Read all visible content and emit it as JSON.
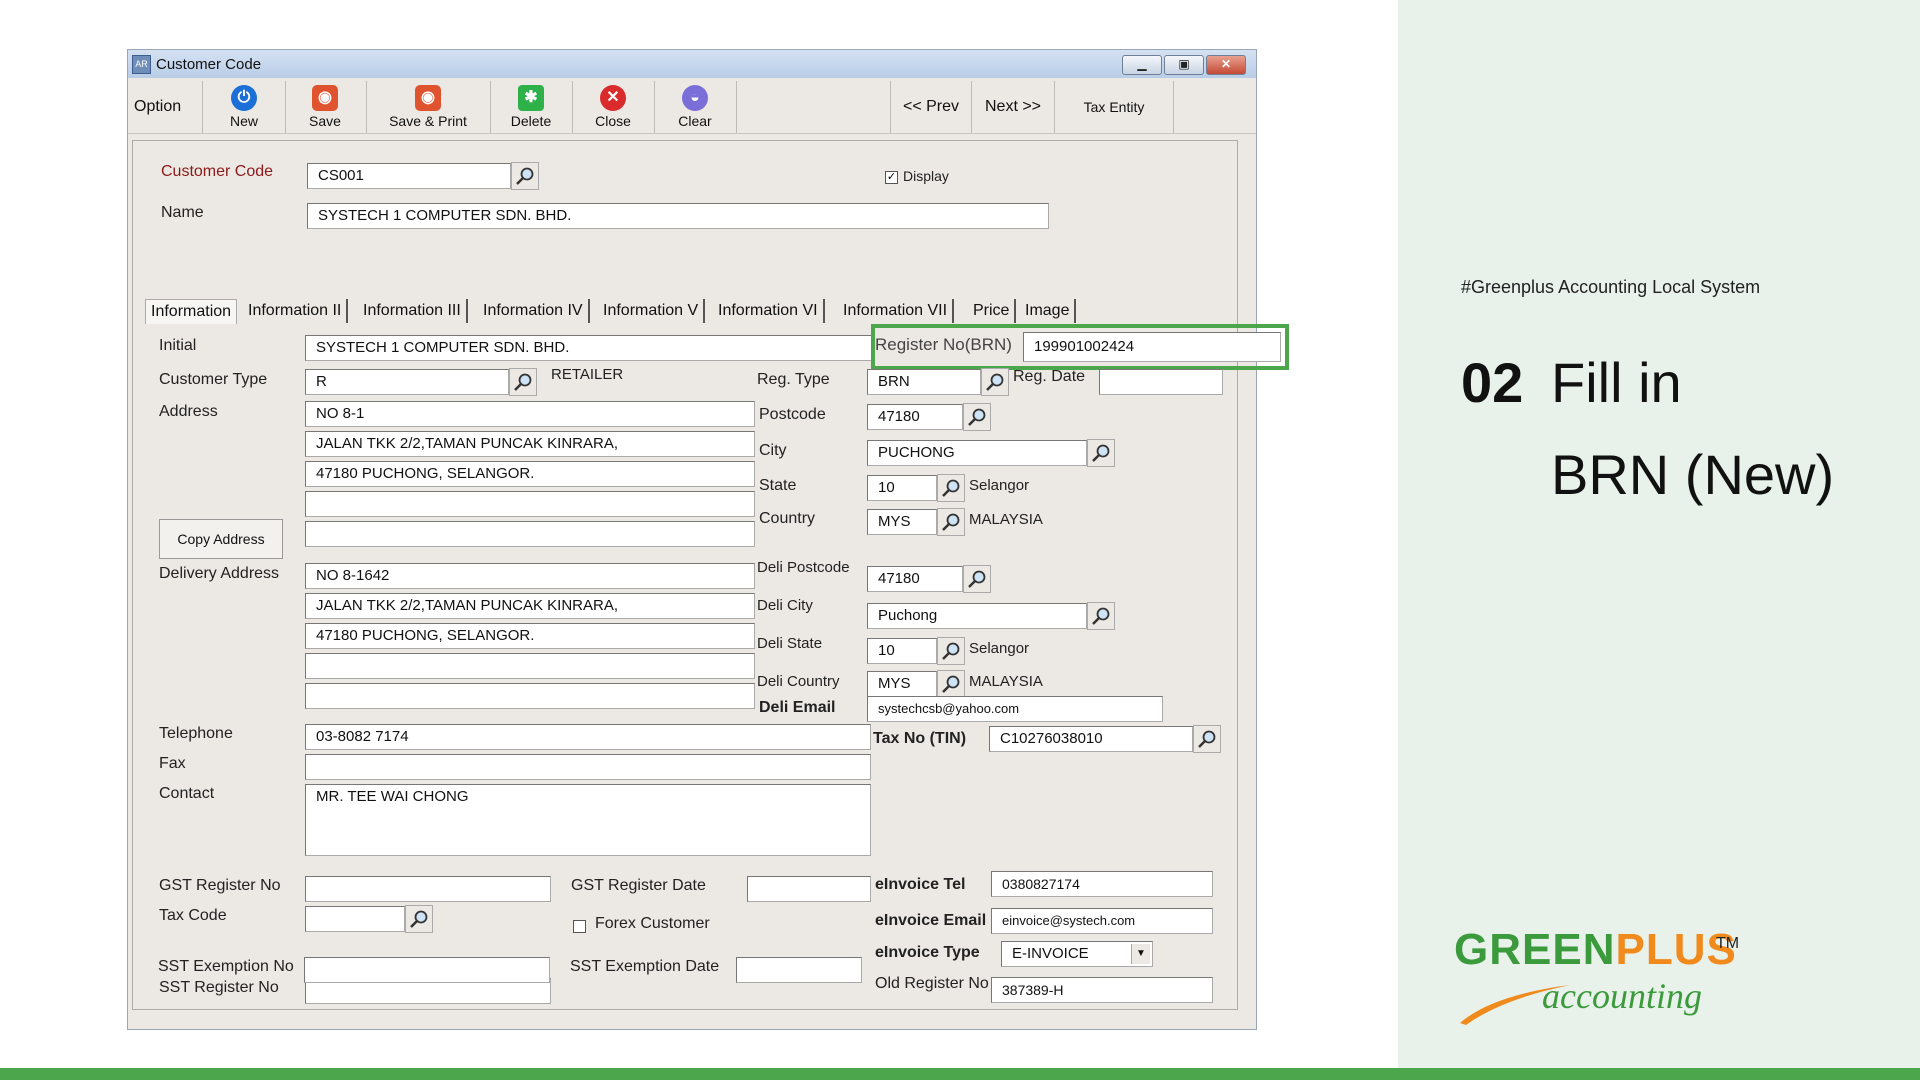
{
  "slide": {
    "hashtag": "#Greenplus Accounting Local System",
    "step_number": "02",
    "step_line1": "Fill in",
    "step_line2": "BRN (New)",
    "logo_green": "GREEN",
    "logo_plus": "PLUS",
    "logo_tm": "TM",
    "logo_accounting": "accounting"
  },
  "window": {
    "title": "Customer Code",
    "app_icon": "AR",
    "controls": [
      "minimize-icon",
      "maximize-icon",
      "close-icon"
    ]
  },
  "toolbar": {
    "option": "Option",
    "new": "New",
    "save": "Save",
    "save_print": "Save & Print",
    "delete": "Delete",
    "close": "Close",
    "clear": "Clear",
    "prev": "<<  Prev",
    "next": "Next  >>",
    "tax_entity": "Tax Entity"
  },
  "header": {
    "customer_code_label": "Customer Code",
    "customer_code": "CS001",
    "display_label": "Display",
    "display_checked": "✓",
    "name_label": "Name",
    "name": "SYSTECH 1 COMPUTER SDN. BHD."
  },
  "tabs": [
    "Information",
    "Information II",
    "Information III",
    "Information IV",
    "Information V",
    "Information VI",
    "Information VII",
    "Price",
    "Image"
  ],
  "form": {
    "initial_label": "Initial",
    "initial": "SYSTECH 1 COMPUTER SDN. BHD.",
    "customer_type_label": "Customer Type",
    "customer_type": "R",
    "customer_type_desc": "RETAILER",
    "address_label": "Address",
    "address": [
      "NO 8-1",
      "JALAN TKK 2/2,TAMAN PUNCAK KINRARA,",
      "47180 PUCHONG, SELANGOR.",
      "",
      ""
    ],
    "copy_address": "Copy Address",
    "delivery_address_label": "Delivery Address",
    "delivery_address": [
      "NO 8-1642",
      "JALAN TKK 2/2,TAMAN PUNCAK KINRARA,",
      "47180 PUCHONG, SELANGOR.",
      "",
      ""
    ],
    "register_no_label": "Register No(BRN)",
    "register_no": "199901002424",
    "reg_type_label": "Reg. Type",
    "reg_type": "BRN",
    "reg_date_label": "Reg. Date",
    "reg_date": "",
    "postcode_label": "Postcode",
    "postcode": "47180",
    "city_label": "City",
    "city": "PUCHONG",
    "state_label": "State",
    "state_code": "10",
    "state_name": "Selangor",
    "country_label": "Country",
    "country_code": "MYS",
    "country_name": "MALAYSIA",
    "deli_postcode_label": "Deli Postcode",
    "deli_postcode": "47180",
    "deli_city_label": "Deli City",
    "deli_city": "Puchong",
    "deli_state_label": "Deli State",
    "deli_state_code": "10",
    "deli_state_name": "Selangor",
    "deli_country_label": "Deli Country",
    "deli_country_code": "MYS",
    "deli_country_name": "MALAYSIA",
    "deli_email_label": "Deli Email",
    "deli_email": "systechcsb@yahoo.com",
    "telephone_label": "Telephone",
    "telephone": "03-8082 7174",
    "fax_label": "Fax",
    "fax": "",
    "contact_label": "Contact",
    "contact": "MR. TEE WAI CHONG",
    "tax_no_label": "Tax No (TIN)",
    "tax_no": "C10276038010",
    "gst_reg_no_label": "GST Register No",
    "gst_reg_no": "",
    "gst_reg_date_label": "GST Register Date",
    "gst_reg_date": "",
    "tax_code_label": "Tax Code",
    "tax_code": "",
    "forex_label": "Forex Customer",
    "einv_tel_label": "eInvoice Tel",
    "einv_tel": "0380827174",
    "einv_email_label": "eInvoice Email",
    "einv_email": "einvoice@systech.com",
    "einv_type_label": "eInvoice Type",
    "einv_type": "E-INVOICE",
    "old_reg_label": "Old Register No",
    "old_reg": "387389-H",
    "sst_reg_no_label": "SST Register No",
    "sst_reg_no": "",
    "sst_exemp_no_label": "SST Exemption No",
    "sst_exemp_no": "",
    "sst_exemp_date_label": "SST Exemption Date",
    "sst_exemp_date": ""
  },
  "colors": {
    "highlight": "#4ca64b",
    "brand_green": "#3a9a3c",
    "brand_orange": "#f08a1c",
    "panel": "#e8f1ea"
  }
}
